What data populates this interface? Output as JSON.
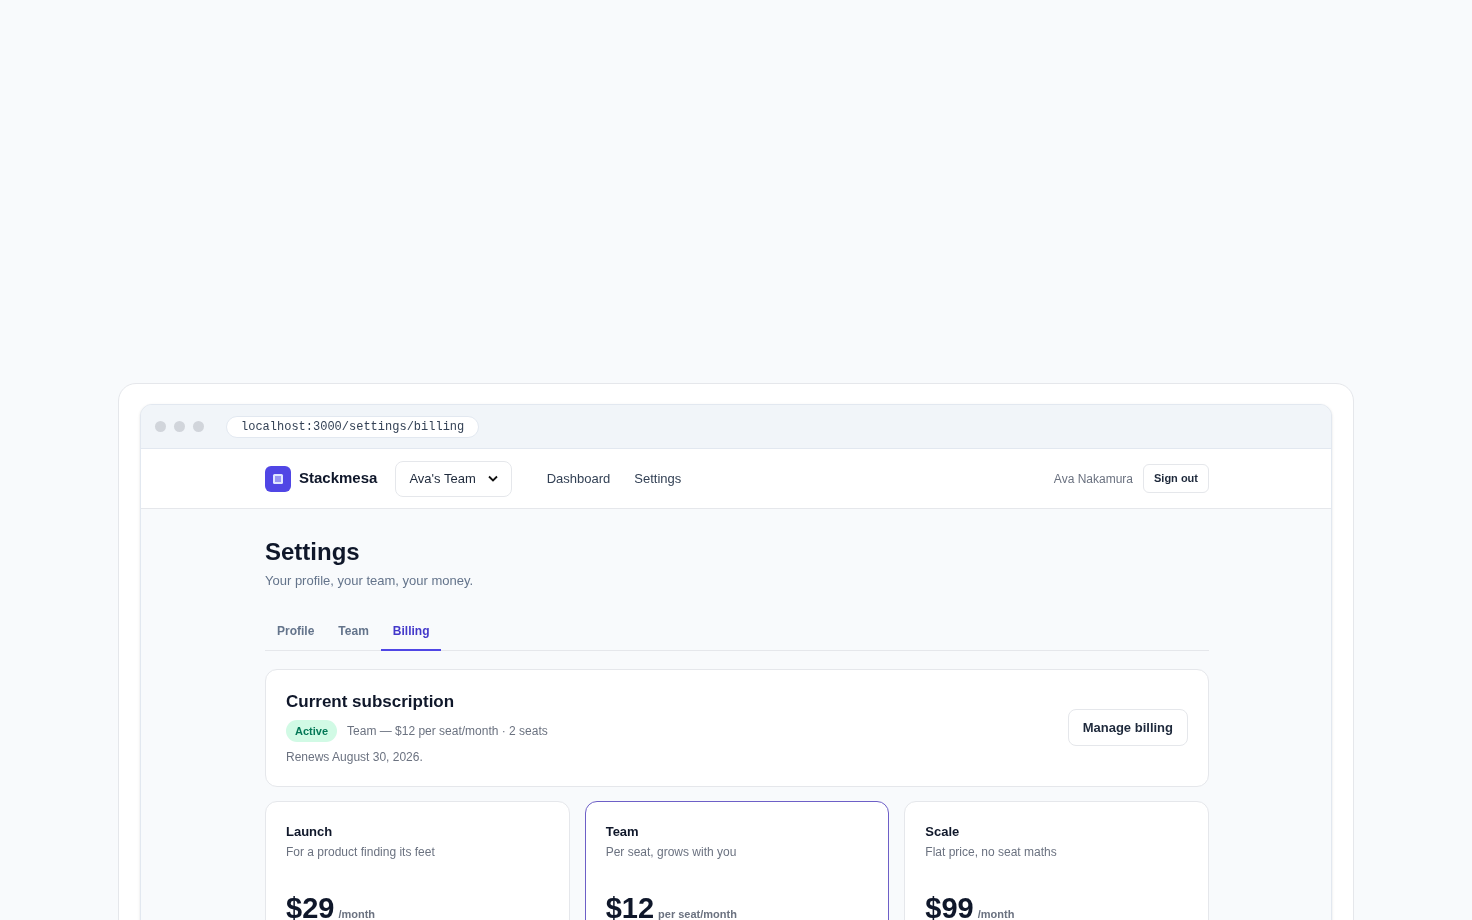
{
  "browser": {
    "url": "localhost:3000/settings/billing"
  },
  "nav": {
    "brand": "Stackmesa",
    "team_select": "Ava's Team",
    "links": [
      {
        "label": "Dashboard"
      },
      {
        "label": "Settings"
      }
    ],
    "user": "Ava Nakamura",
    "sign_out": "Sign out"
  },
  "header": {
    "title": "Settings",
    "subtitle": "Your profile, your team, your money."
  },
  "tabs": [
    {
      "label": "Profile",
      "selected": false
    },
    {
      "label": "Team",
      "selected": false
    },
    {
      "label": "Billing",
      "selected": true
    }
  ],
  "subscription": {
    "title": "Current subscription",
    "status": "Active",
    "summary": "Team — $12 per seat/month · 2 seats",
    "renews": "Renews August 30, 2026.",
    "button": "Manage billing"
  },
  "plans": [
    {
      "name": "Launch",
      "tagline": "For a product finding its feet",
      "price": "$29",
      "period": "/month",
      "selected": false
    },
    {
      "name": "Team",
      "tagline": "Per seat, grows with you",
      "price": "$12",
      "period": "per seat/month",
      "selected": true
    },
    {
      "name": "Scale",
      "tagline": "Flat price, no seat maths",
      "price": "$99",
      "period": "/month",
      "selected": false
    }
  ]
}
